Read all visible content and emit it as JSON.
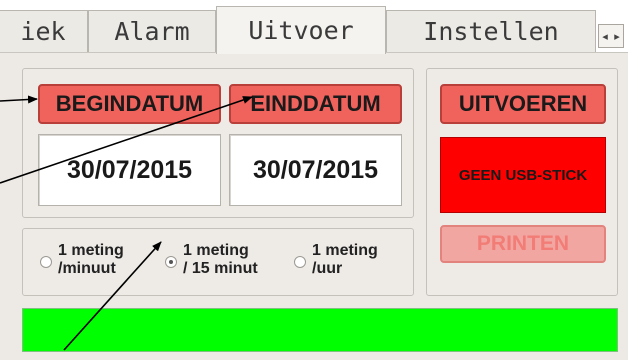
{
  "tabs": [
    {
      "label": "iek",
      "active": false
    },
    {
      "label": "Alarm",
      "active": false
    },
    {
      "label": "Uitvoer",
      "active": true
    },
    {
      "label": "Instellen",
      "active": false
    }
  ],
  "tab_scroll": {
    "left": "◂",
    "right": "▸"
  },
  "dates": {
    "begin_button": "BEGINDATUM",
    "end_button": "EINDDATUM",
    "begin_value": "30/07/2015",
    "end_value": "30/07/2015"
  },
  "intervals": [
    {
      "line1": "1 meting",
      "line2": "/minuut",
      "selected": false
    },
    {
      "line1": "1 meting",
      "line2": "/ 15 minut",
      "selected": true
    },
    {
      "line1": "1 meting",
      "line2": "/uur",
      "selected": false
    }
  ],
  "actions": {
    "export_button": "UITVOEREN",
    "usb_status": "GEEN USB-STICK",
    "print_button": "PRINTEN"
  },
  "colors": {
    "button_red": "#f0625c",
    "usb_status_bg": "#ff0000",
    "status_bar": "#00ff00",
    "print_disabled": "#f2a6a2"
  }
}
